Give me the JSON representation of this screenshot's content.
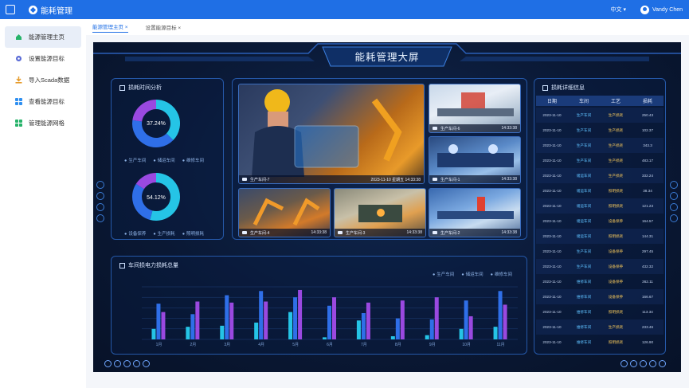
{
  "header": {
    "app_title": "能耗管理",
    "language": "中文",
    "user": "Vandy Chen"
  },
  "sidebar": {
    "items": [
      {
        "label": "能源管理主页",
        "icon": "home-icon",
        "color": "#27b36a"
      },
      {
        "label": "设置能源目标",
        "icon": "gear-icon",
        "color": "#5a6bd6"
      },
      {
        "label": "导入Scada数据",
        "icon": "import-icon",
        "color": "#e69b2b"
      },
      {
        "label": "查看能源目标",
        "icon": "grid-icon",
        "color": "#2f8ff0"
      },
      {
        "label": "管理能源网格",
        "icon": "grid-green-icon",
        "color": "#27b36a"
      }
    ]
  },
  "tabs": [
    {
      "label": "能源管理主页 ×"
    },
    {
      "label": "设置能源目标 ×"
    }
  ],
  "dashboard": {
    "title": "能耗管理大屏",
    "time_analysis_title": "损耗时间分析",
    "donut1": {
      "center": "37.24%",
      "legend": [
        "生产车间",
        "储运车间",
        "维修车间"
      ],
      "colors": [
        "#25c4e6",
        "#2f6fe8",
        "#9a49e0"
      ],
      "values": [
        37.24,
        40,
        22.76
      ]
    },
    "donut2": {
      "center": "54.12%",
      "legend": [
        "设备保养",
        "生产损耗",
        "照明损耗"
      ],
      "colors": [
        "#25c4e6",
        "#2f6fe8",
        "#9a49e0"
      ],
      "values": [
        54.12,
        30,
        15.88
      ]
    },
    "cameras": [
      {
        "name": "生产车间-7",
        "date": "2023-11-10",
        "weekday": "星期五",
        "time": "14:33:38"
      },
      {
        "name": "生产车间-6",
        "time": "14:33:38"
      },
      {
        "name": "生产车间-1",
        "time": "14:33:38"
      },
      {
        "name": "生产车间-4",
        "time": "14:33:38"
      },
      {
        "name": "生产车间-3",
        "time": "14:33:38"
      },
      {
        "name": "生产车间-2",
        "time": "14:33:38"
      }
    ],
    "detail_title": "损耗详细信息",
    "table_headers": [
      "日期",
      "车间",
      "工艺",
      "损耗"
    ],
    "table_rows": [
      [
        "2023-11-10",
        "生产车间",
        "生产损耗",
        "250.43"
      ],
      [
        "2023-11-10",
        "生产车间",
        "生产损耗",
        "102.37"
      ],
      [
        "2023-11-10",
        "生产车间",
        "生产损耗",
        "343.3"
      ],
      [
        "2023-11-10",
        "生产车间",
        "生产损耗",
        "483.17"
      ],
      [
        "2023-11-10",
        "储运车间",
        "生产损耗",
        "332.24"
      ],
      [
        "2023-11-10",
        "储运车间",
        "照明损耗",
        "38.34"
      ],
      [
        "2023-11-10",
        "储运车间",
        "照明损耗",
        "121.23"
      ],
      [
        "2023-11-10",
        "储运车间",
        "设备保养",
        "164.57"
      ],
      [
        "2023-11-10",
        "储运车间",
        "照明损耗",
        "144.31"
      ],
      [
        "2023-11-10",
        "生产车间",
        "设备保养",
        "297.45"
      ],
      [
        "2023-11-10",
        "生产车间",
        "设备保养",
        "432.32"
      ],
      [
        "2023-11-10",
        "维修车间",
        "设备保养",
        "362.11"
      ],
      [
        "2023-11-10",
        "维修车间",
        "设备保养",
        "166.67"
      ],
      [
        "2023-11-10",
        "维修车间",
        "照明损耗",
        "113.34"
      ],
      [
        "2023-11-10",
        "维修车间",
        "生产损耗",
        "233.46"
      ],
      [
        "2023-11-10",
        "维修车间",
        "照明损耗",
        "126.90"
      ]
    ],
    "bar_title": "车间损电力损耗总量"
  },
  "chart_data": {
    "type": "bar",
    "categories": [
      "1月",
      "2月",
      "3月",
      "4月",
      "5月",
      "6月",
      "7月",
      "8月",
      "9月",
      "10月",
      "11月"
    ],
    "series": [
      {
        "name": "生产车间",
        "color": "#25c4e6",
        "values": [
          50,
          60,
          65,
          80,
          130,
          10,
          90,
          15,
          20,
          50,
          60
        ]
      },
      {
        "name": "储运车间",
        "color": "#2f6fe8",
        "values": [
          170,
          120,
          210,
          230,
          200,
          160,
          125,
          100,
          95,
          185,
          230
        ]
      },
      {
        "name": "维修车间",
        "color": "#9a49e0",
        "values": [
          130,
          180,
          175,
          180,
          235,
          200,
          175,
          185,
          200,
          110,
          165
        ]
      }
    ],
    "ylim": [
      0,
      250
    ],
    "legend_position": "top-right"
  }
}
